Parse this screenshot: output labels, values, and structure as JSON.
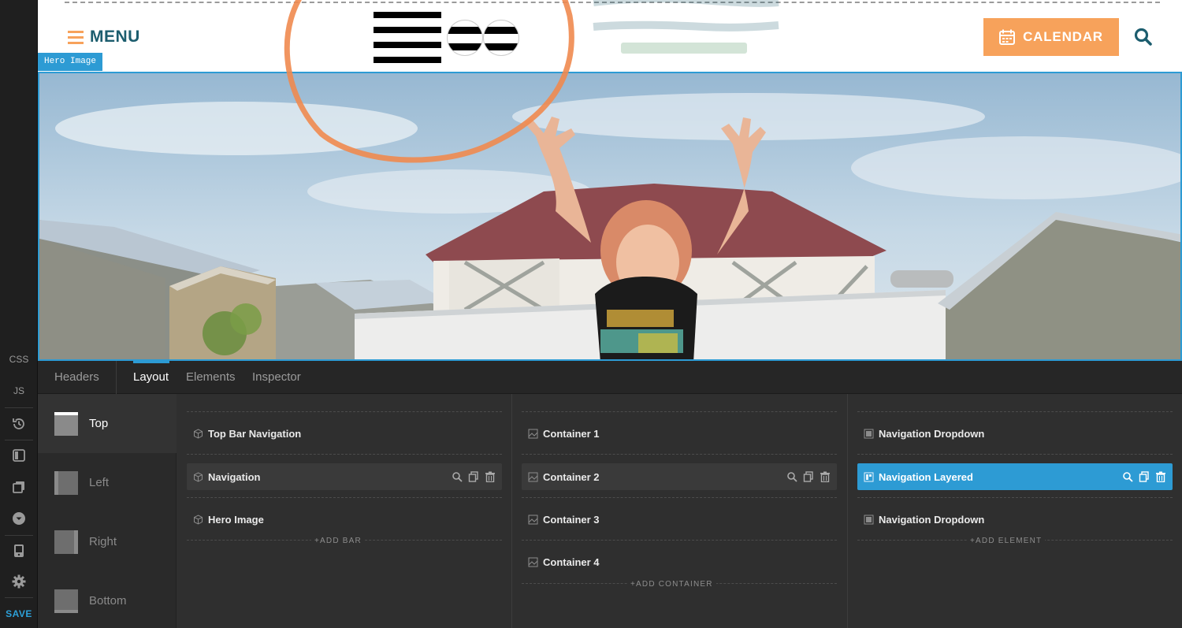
{
  "rail": {
    "css_label": "CSS",
    "js_label": "JS",
    "save_label": "SAVE"
  },
  "site": {
    "menu_label": "MENU",
    "calendar_label": "CALENDAR",
    "hero_tag": "Hero Image",
    "colors": {
      "brand_teal": "#1c5d6e",
      "calendar_orange": "#f7a25b",
      "accent_blue": "#2d9bd4"
    }
  },
  "editor": {
    "tabs": [
      {
        "label": "Headers",
        "active": false
      },
      {
        "label": "Layout",
        "active": true
      },
      {
        "label": "Elements",
        "active": false
      },
      {
        "label": "Inspector",
        "active": false
      }
    ],
    "regions": [
      {
        "label": "Top",
        "active": true
      },
      {
        "label": "Left",
        "active": false
      },
      {
        "label": "Right",
        "active": false
      },
      {
        "label": "Bottom",
        "active": false
      }
    ],
    "bars": {
      "items": [
        {
          "label": "Top Bar Navigation",
          "state": "normal"
        },
        {
          "label": "Navigation",
          "state": "hover"
        },
        {
          "label": "Hero Image",
          "state": "normal"
        }
      ],
      "add_label": "+ADD BAR"
    },
    "containers": {
      "items": [
        {
          "label": "Container 1",
          "state": "normal"
        },
        {
          "label": "Container 2",
          "state": "hover"
        },
        {
          "label": "Container 3",
          "state": "normal"
        },
        {
          "label": "Container 4",
          "state": "normal"
        }
      ],
      "add_label": "+ADD CONTAINER"
    },
    "elements": {
      "items": [
        {
          "label": "Navigation Dropdown",
          "state": "normal"
        },
        {
          "label": "Navigation Layered",
          "state": "selected"
        },
        {
          "label": "Navigation Dropdown",
          "state": "normal"
        }
      ],
      "add_label": "+ADD ELEMENT"
    }
  }
}
